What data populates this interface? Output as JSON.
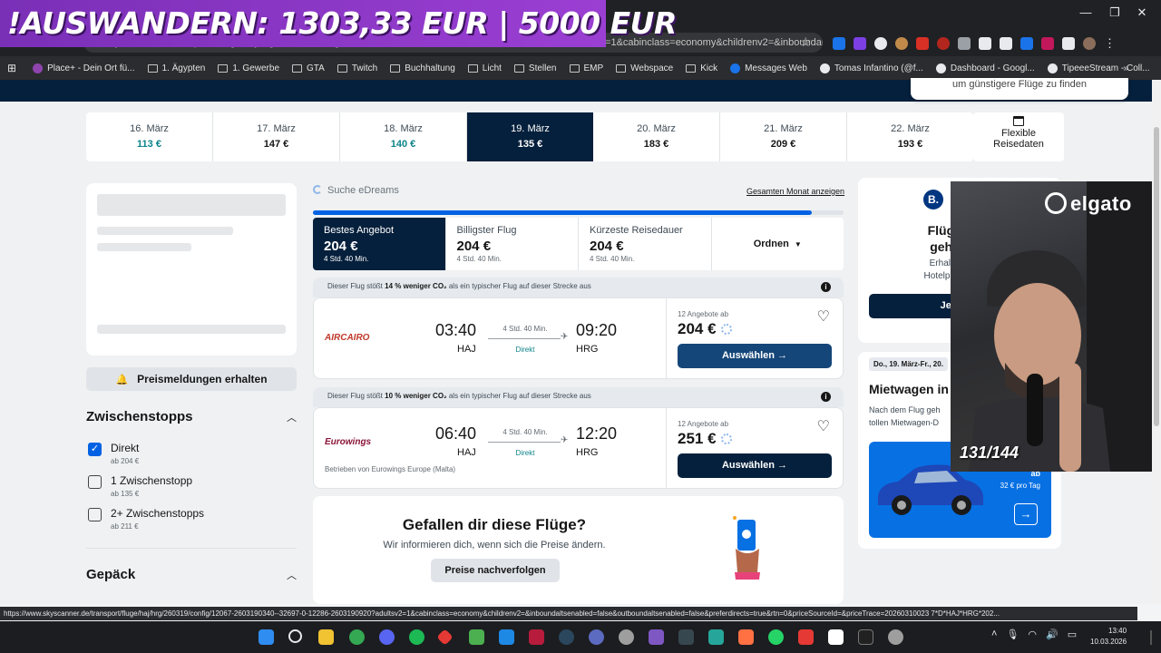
{
  "overlay": {
    "banner": "!AUSWANDERN: 1303,33 EUR | 5000 EUR"
  },
  "browser": {
    "url": "skyscanner.de/transport/fluege/haj/hrg/260319/config/12067-2603190340--32697-0-12286-2603190920?adultsv2=1&cabinclass=economy&childrenv2=&inboundaltsenabled=false&outboundaltsenabled=false&prefer...",
    "bookmarks": [
      "Place+ - Dein Ort fü...",
      "1. Ägypten",
      "1. Gewerbe",
      "GTA",
      "Twitch",
      "Buchhaltung",
      "Licht",
      "Stellen",
      "EMP",
      "Webspace",
      "Kick",
      "Messages Web",
      "Tomas Infantino (@f...",
      "Dashboard - Googl...",
      "TipeeeStream - Coll..."
    ],
    "status_url": "https://www.skyscanner.de/transport/fluge/haj/hrg/260319/config/12067-2603190340--32697-0-12286-2603190920?adultsv2=1&cabinclass=economy&childrenv2=&inboundaltsenabled=false&outboundaltsenabled=false&preferdirects=true&rtn=0&priceSourceId=&priceTrace=20260310023 7*D*HAJ*HRG*202..."
  },
  "tooltip": "um günstigere Flüge zu finden",
  "dates": [
    {
      "date": "16. März",
      "price": "113 €",
      "green": true,
      "active": false
    },
    {
      "date": "17. März",
      "price": "147 €",
      "green": false,
      "active": false
    },
    {
      "date": "18. März",
      "price": "140 €",
      "green": true,
      "active": false
    },
    {
      "date": "19. März",
      "price": "135 €",
      "green": false,
      "active": true
    },
    {
      "date": "20. März",
      "price": "183 €",
      "green": false,
      "active": false
    },
    {
      "date": "21. März",
      "price": "209 €",
      "green": false,
      "active": false
    },
    {
      "date": "22. März",
      "price": "193 €",
      "green": false,
      "active": false
    }
  ],
  "flexible": {
    "line1": "Flexible",
    "line2": "Reisedaten"
  },
  "sidebar": {
    "price_alert": "Preismeldungen erhalten",
    "stops_title": "Zwischenstopps",
    "stops": [
      {
        "label": "Direkt",
        "sub": "ab 204 €",
        "checked": true
      },
      {
        "label": "1 Zwischenstopp",
        "sub": "ab 135 €",
        "checked": false
      },
      {
        "label": "2+ Zwischenstopps",
        "sub": "ab 211 €",
        "checked": false
      }
    ],
    "baggage_title": "Gepäck"
  },
  "results": {
    "searching": "Suche eDreams",
    "month_link": "Gesamten Monat anzeigen",
    "progress": 0.94,
    "sort_tabs": [
      {
        "title": "Bestes Angebot",
        "price": "204 €",
        "duration": "4 Std. 40 Min."
      },
      {
        "title": "Billigster Flug",
        "price": "204 €",
        "duration": "4 Std. 40 Min."
      },
      {
        "title": "Kürzeste Reisedauer",
        "price": "204 €",
        "duration": "4 Std. 40 Min."
      }
    ],
    "order_label": "Ordnen",
    "flights": [
      {
        "eco_pre": "Dieser Flug stößt",
        "eco_bold": "14 % weniger CO₂",
        "eco_post": "als ein typischer Flug auf dieser Strecke aus",
        "airline": "AIRCAIRO",
        "dep": "03:40",
        "arr": "09:20",
        "from": "HAJ",
        "to": "HRG",
        "duration": "4 Std. 40 Min.",
        "stops": "Direkt",
        "operator": "",
        "deals": "12 Angebote ab",
        "price": "204 €",
        "select": "Auswählen →"
      },
      {
        "eco_pre": "Dieser Flug stößt",
        "eco_bold": "10 % weniger CO₂",
        "eco_post": "als ein typischer Flug auf dieser Strecke aus",
        "airline": "Eurowings",
        "dep": "06:40",
        "arr": "12:20",
        "from": "HAJ",
        "to": "HRG",
        "duration": "4 Std. 40 Min.",
        "stops": "Direkt",
        "operator": "Betrieben von Eurowings Europe (Malta)",
        "deals": "12 Angebote ab",
        "price": "251 €",
        "select": "Auswählen →"
      }
    ],
    "follow": {
      "title": "Gefallen dir diese Flüge?",
      "text": "Wir informieren dich, wenn sich die Preise ändern.",
      "button": "Preise nachverfolgen"
    }
  },
  "ads": {
    "booking": {
      "logo": "B.",
      "title_1": "Flüge gefu",
      "title_2": "geht's zur",
      "text_1": "Erhalte Ergebn",
      "text_2": "Hotelportalen dire",
      "button": "Jetzt Ho"
    },
    "car": {
      "tag": "Do., 19. März-Fr., 20.",
      "title": "Mietwagen in",
      "text_1": "Nach dem Flug geh",
      "text_2": "tollen Mietwagen-D",
      "price_prefix": "ab",
      "price": "32 € pro Tag"
    }
  },
  "webcam": {
    "brand": "elgato",
    "counter": "131/144"
  },
  "taskbar": {
    "time": "13:40",
    "date": "10.03.2026"
  }
}
